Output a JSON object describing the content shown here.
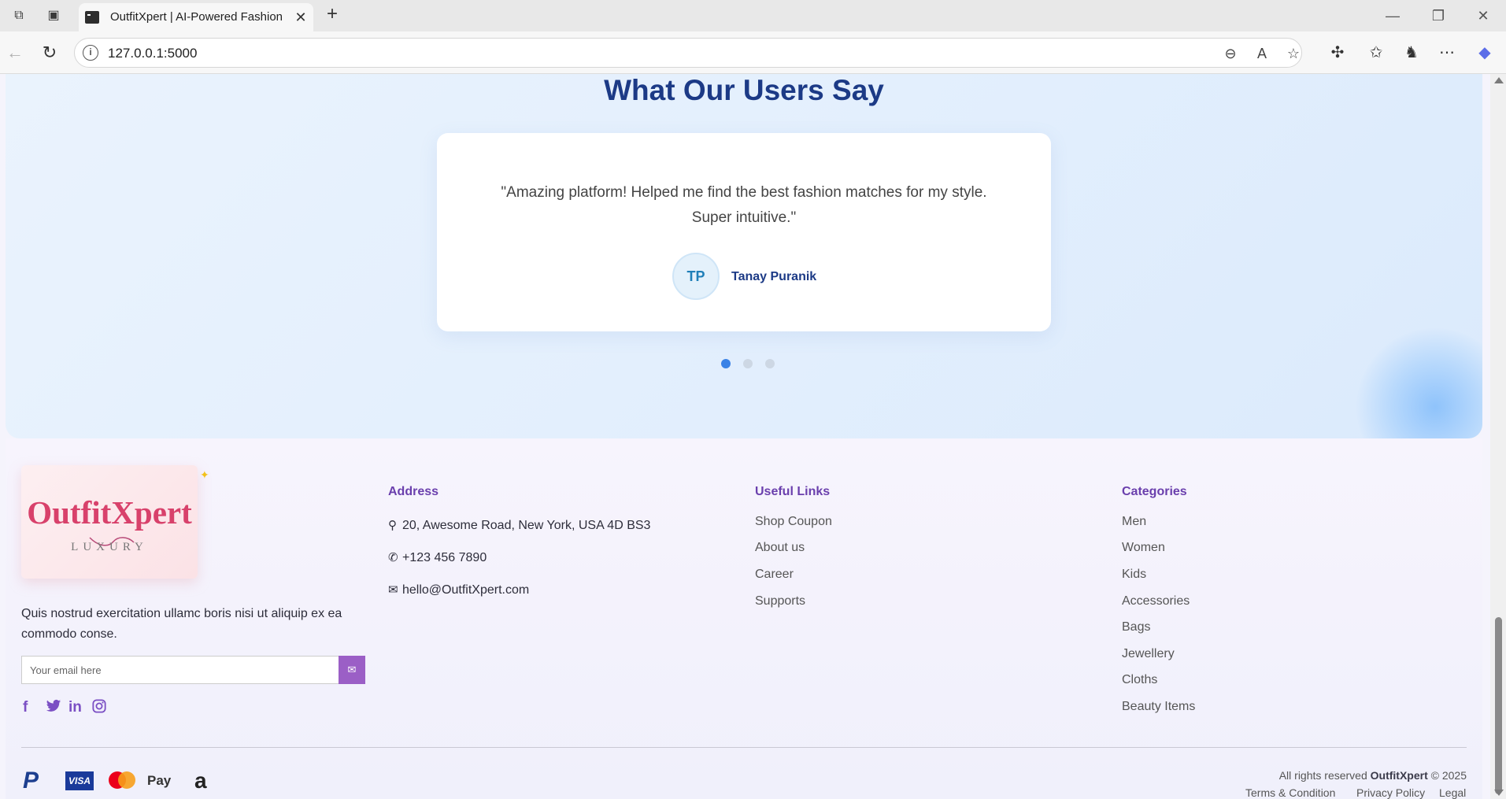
{
  "browser": {
    "tab_title": "OutfitXpert | AI-Powered Fashion",
    "url": "127.0.0.1:5000"
  },
  "testimonials": {
    "heading": "What Our Users Say",
    "quote": "\"Amazing platform! Helped me find the best fashion matches for my style. Super intuitive.\"",
    "avatar_initials": "TP",
    "author": "Tanay Puranik",
    "dots": [
      {
        "active": true
      },
      {
        "active": false
      },
      {
        "active": false
      }
    ]
  },
  "footer": {
    "logo": {
      "name": "OutfitXpert",
      "tagline": "LUXURY"
    },
    "about": "Quis nostrud exercitation ullamc boris nisi ut aliquip ex ea commodo conse.",
    "email_placeholder": "Your email here",
    "social": [
      "facebook-icon",
      "twitter-icon",
      "linkedin-icon",
      "instagram-icon"
    ],
    "address": {
      "title": "Address",
      "street": "20, Awesome Road, New York, USA 4D BS3",
      "phone": "+123 456 7890",
      "email": "hello@OutfitXpert.com"
    },
    "useful_links": {
      "title": "Useful Links",
      "items": [
        "Shop Coupon",
        "About us",
        "Career",
        "Supports"
      ]
    },
    "categories": {
      "title": "Categories",
      "items": [
        "Men",
        "Women",
        "Kids",
        "Accessories",
        "Bags",
        "Jewellery",
        "Cloths",
        "Beauty Items"
      ]
    },
    "copyright": {
      "prefix": "All rights reserved ",
      "brand": "OutfitXpert",
      "suffix": " © 2025"
    },
    "legal_links": [
      "Terms & Condition",
      "Privacy Policy",
      "Legal"
    ],
    "payment_methods": [
      "PayPal",
      "VISA",
      "Mastercard",
      "Apple Pay",
      "Amazon"
    ]
  },
  "colors": {
    "heading": "#1c3a86",
    "accent_purple": "#6a3fad",
    "logo_pink": "#d8416b",
    "active_dot": "#3a82e6"
  }
}
